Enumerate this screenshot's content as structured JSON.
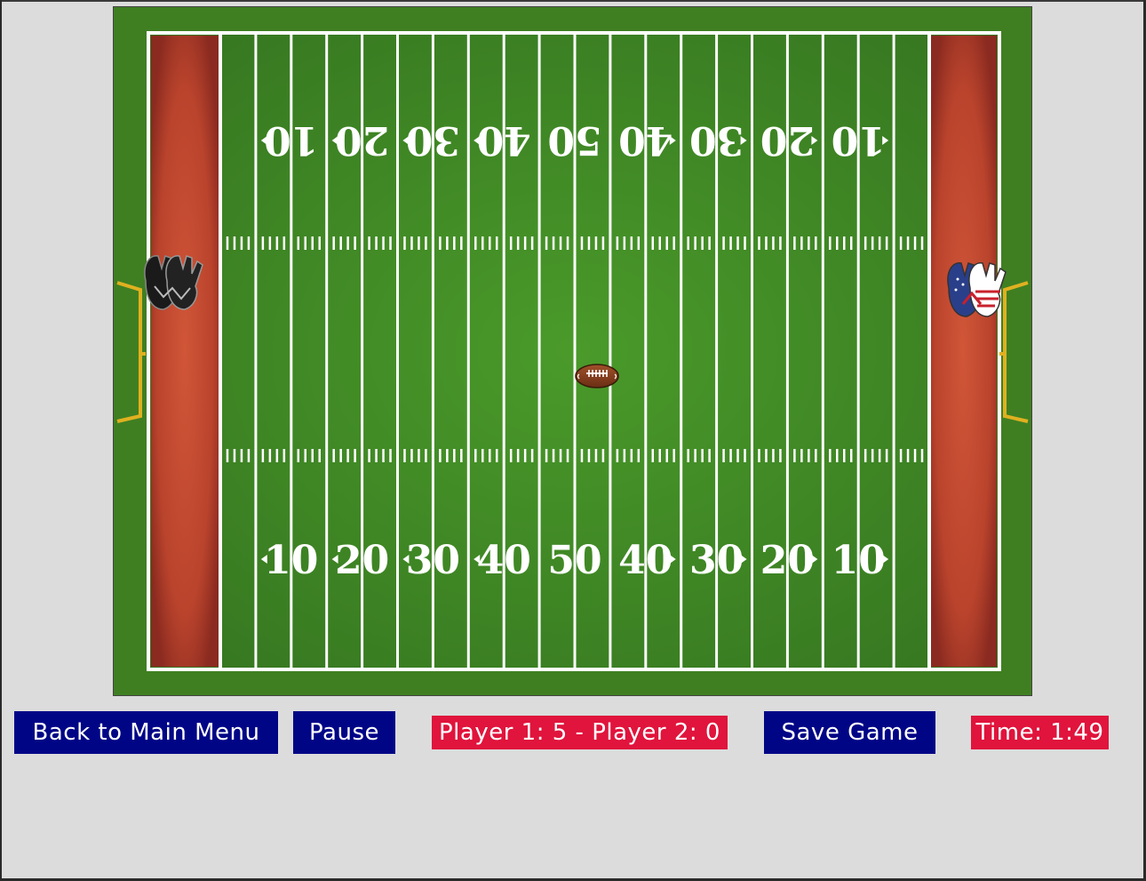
{
  "field": {
    "yard_numbers": [
      "10",
      "20",
      "30",
      "40",
      "50",
      "40",
      "30",
      "20",
      "10"
    ]
  },
  "players": {
    "player1_icon": "black-gloves-icon",
    "player2_icon": "usa-flag-gloves-icon"
  },
  "ball_icon": "football-icon",
  "controls": {
    "back_label": "Back to Main Menu",
    "pause_label": "Pause",
    "score_text": "Player 1: 5 - Player 2: 0",
    "save_label": "Save Game",
    "time_text": "Time: 1:49"
  },
  "colors": {
    "turf": "#3f7f22",
    "endzone": "#c14a32",
    "button": "#000586",
    "badge": "#e0143c",
    "goalpost": "#e0b020"
  }
}
